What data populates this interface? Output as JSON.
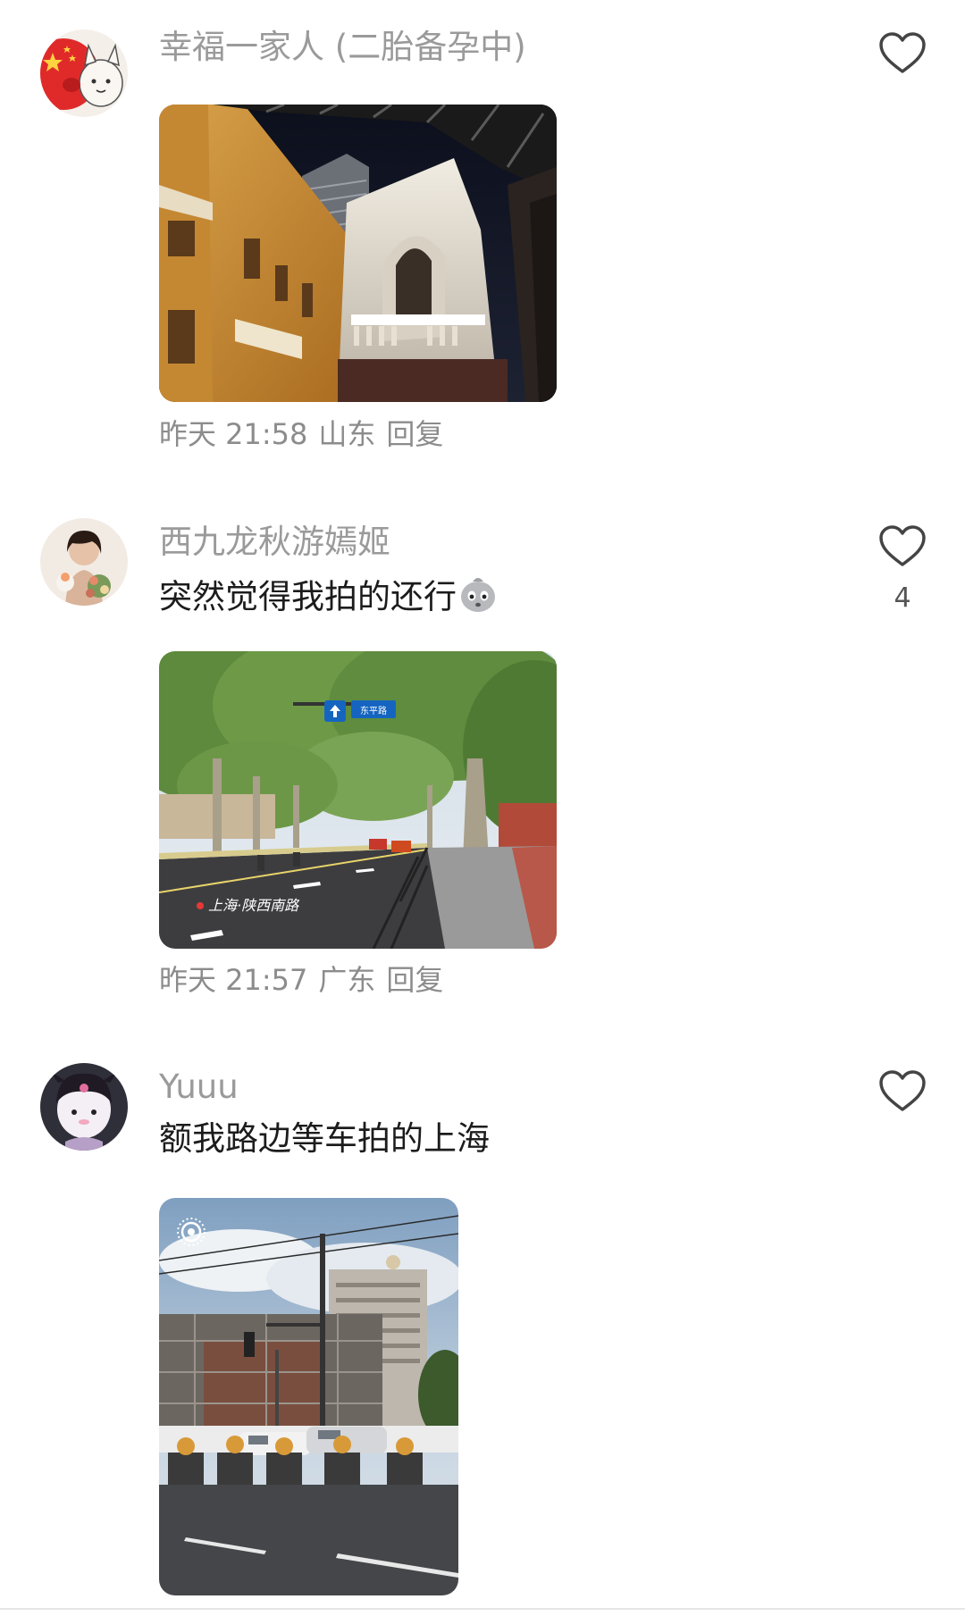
{
  "comments": [
    {
      "username": "幸福一家人 (二胎备孕中)",
      "text": "",
      "time": "昨天 21:58",
      "location": "山东",
      "reply_label": "回复",
      "like_count": ""
    },
    {
      "username": "西九龙秋游嫣姬",
      "text": "突然觉得我拍的还行",
      "time": "昨天 21:57",
      "location": "广东",
      "reply_label": "回复",
      "like_count": "4"
    },
    {
      "username": "Yuuu",
      "text": "额我路边等车拍的上海",
      "time": "",
      "location": "",
      "reply_label": "",
      "like_count": ""
    }
  ],
  "photos": {
    "street_sign_text": "上海·陕西南路",
    "road_sign_text": "东平路"
  },
  "icons": {
    "like": "heart-outline-icon",
    "emoji": "crying-face-emoji-icon",
    "live_photo": "live-photo-icon"
  },
  "colors": {
    "username": "#9a9a9a",
    "text": "#1c1c1c",
    "meta": "#8c8c8c",
    "like_icon": "#444444"
  }
}
